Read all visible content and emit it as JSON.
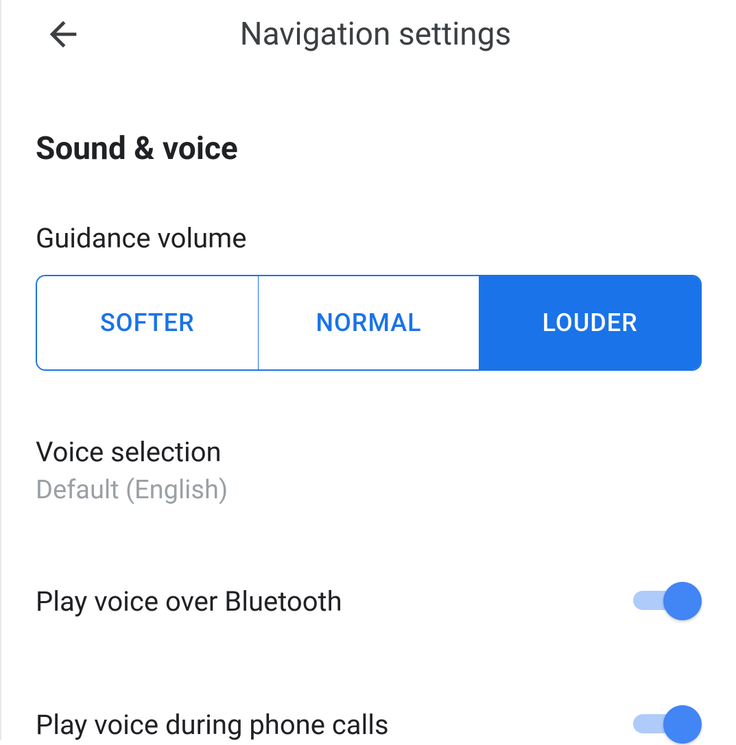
{
  "header": {
    "title": "Navigation settings"
  },
  "section": {
    "title": "Sound & voice"
  },
  "guidance_volume": {
    "label": "Guidance volume",
    "options": {
      "softer": "SOFTER",
      "normal": "NORMAL",
      "louder": "LOUDER"
    },
    "selected": "louder"
  },
  "voice_selection": {
    "title": "Voice selection",
    "subtitle": "Default (English)"
  },
  "toggles": {
    "bluetooth": {
      "label": "Play voice over Bluetooth",
      "enabled": true
    },
    "phone_calls": {
      "label": "Play voice during phone calls",
      "enabled": true
    }
  }
}
